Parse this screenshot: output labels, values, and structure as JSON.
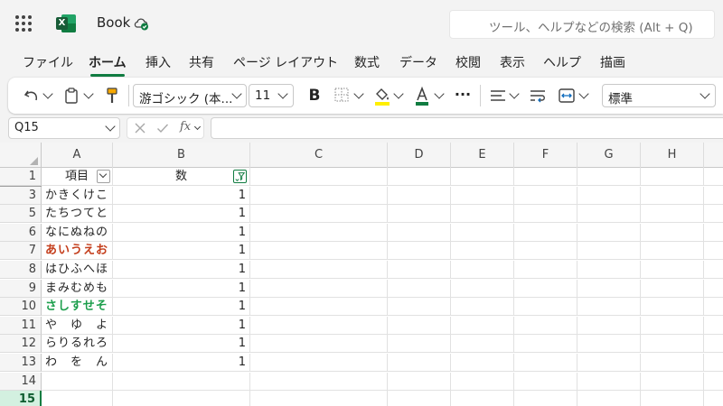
{
  "app": {
    "doc_title": "Book",
    "search_placeholder": "ツール、ヘルプなどの検索 (Alt + Q)"
  },
  "colors": {
    "accent": "#107c41",
    "red_text": "#c43e1c",
    "green_text": "#1b9e4b"
  },
  "menu_tabs": [
    {
      "label": "ファイル",
      "active": false
    },
    {
      "label": "ホーム",
      "active": true
    },
    {
      "label": "挿入",
      "active": false
    },
    {
      "label": "共有",
      "active": false
    },
    {
      "label": "ページ レイアウト",
      "active": false
    },
    {
      "label": "数式",
      "active": false
    },
    {
      "label": "データ",
      "active": false
    },
    {
      "label": "校閲",
      "active": false
    },
    {
      "label": "表示",
      "active": false
    },
    {
      "label": "ヘルプ",
      "active": false
    },
    {
      "label": "描画",
      "active": false
    }
  ],
  "ribbon": {
    "font_name": "游ゴシック (本...",
    "font_size": "11",
    "bold_label": "B",
    "number_format": "標準",
    "more_label": "···"
  },
  "formula_bar": {
    "name_box": "Q15",
    "fx_label": "fx",
    "formula": ""
  },
  "columns": [
    "A",
    "B",
    "C",
    "D",
    "E",
    "F",
    "G",
    "H"
  ],
  "header_row": {
    "row": "1",
    "a": "項目",
    "b": "数"
  },
  "rows": [
    {
      "row": "3",
      "a": "かきくけこ",
      "b": "1",
      "style": "normal"
    },
    {
      "row": "5",
      "a": "たちつてと",
      "b": "1",
      "style": "normal"
    },
    {
      "row": "6",
      "a": "なにぬねの",
      "b": "1",
      "style": "normal"
    },
    {
      "row": "7",
      "a": "あいうえお",
      "b": "1",
      "style": "red"
    },
    {
      "row": "8",
      "a": "はひふへほ",
      "b": "1",
      "style": "normal"
    },
    {
      "row": "9",
      "a": "まみむめも",
      "b": "1",
      "style": "normal"
    },
    {
      "row": "10",
      "a": "さしすせそ",
      "b": "1",
      "style": "green"
    },
    {
      "row": "11",
      "a": "や　ゆ　よ",
      "b": "1",
      "style": "normal"
    },
    {
      "row": "12",
      "a": "らりるれろ",
      "b": "1",
      "style": "normal"
    },
    {
      "row": "13",
      "a": "わ　を　ん",
      "b": "1",
      "style": "normal"
    },
    {
      "row": "14",
      "a": "",
      "b": "",
      "style": "normal"
    },
    {
      "row": "15",
      "a": "",
      "b": "",
      "style": "selected"
    }
  ]
}
